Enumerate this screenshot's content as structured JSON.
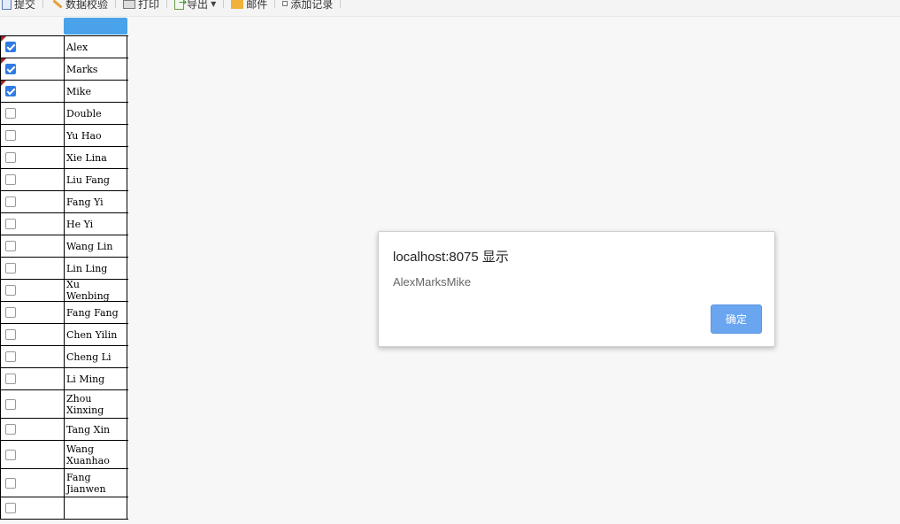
{
  "toolbar": {
    "items": [
      {
        "label": "提交",
        "icon": "submit-icon"
      },
      {
        "label": "数据校验",
        "icon": "validate-icon"
      },
      {
        "label": "打印",
        "icon": "print-icon"
      },
      {
        "label": "导出",
        "icon": "export-icon",
        "dropdown": true
      },
      {
        "label": "邮件",
        "icon": "mail-icon"
      },
      {
        "label": "添加记录",
        "icon": "add-record-icon"
      }
    ]
  },
  "grid": {
    "header_color": "#4aa3ea",
    "rows": [
      {
        "name": "Alex",
        "checked": true,
        "dirty": true
      },
      {
        "name": "Marks",
        "checked": true,
        "dirty": true
      },
      {
        "name": "Mike",
        "checked": true,
        "dirty": true
      },
      {
        "name": "Double",
        "checked": false
      },
      {
        "name": "Yu Hao",
        "checked": false
      },
      {
        "name": "Xie Lina",
        "checked": false
      },
      {
        "name": "Liu Fang",
        "checked": false
      },
      {
        "name": "Fang Yi",
        "checked": false
      },
      {
        "name": "He Yi",
        "checked": false
      },
      {
        "name": "Wang Lin",
        "checked": false
      },
      {
        "name": "Lin Ling",
        "checked": false
      },
      {
        "name": "Xu Wenbing",
        "checked": false
      },
      {
        "name": "Fang Fang",
        "checked": false
      },
      {
        "name": "Chen Yilin",
        "checked": false
      },
      {
        "name": "Cheng Li",
        "checked": false
      },
      {
        "name": "Li Ming",
        "checked": false
      },
      {
        "name": "Zhou Xinxing",
        "checked": false
      },
      {
        "name": "Tang Xin",
        "checked": false
      },
      {
        "name": "Wang Xuanhao",
        "checked": false
      },
      {
        "name": "Fang Jianwen",
        "checked": false
      },
      {
        "name": "",
        "checked": false
      }
    ]
  },
  "dialog": {
    "title": "localhost:8075 显示",
    "message": "AlexMarksMike",
    "ok_label": "确定"
  }
}
